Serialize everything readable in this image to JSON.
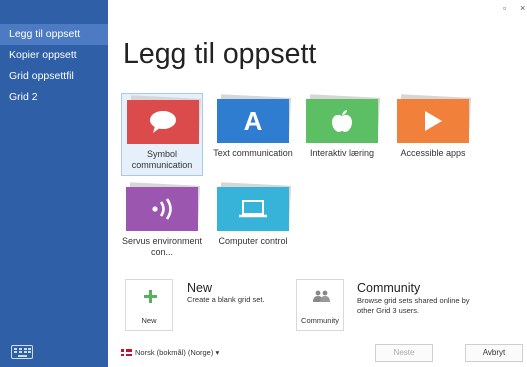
{
  "sidebar": {
    "items": [
      {
        "label": "Legg til oppsett"
      },
      {
        "label": "Kopier oppsett"
      },
      {
        "label": "Grid oppsettfil"
      },
      {
        "label": "Grid 2"
      }
    ],
    "keyboard_icon": "keyboard-icon"
  },
  "window": {
    "maximize_glyph": "▫",
    "close_glyph": "×"
  },
  "main": {
    "title": "Legg til oppsett",
    "tiles": [
      {
        "label": "Symbol communication",
        "color": "#dc4b4b",
        "icon": "speech-bubble-icon",
        "selected": true
      },
      {
        "label": "Text communication",
        "color": "#2e7dd1",
        "icon": "letter-a-icon",
        "glyph": "A"
      },
      {
        "label": "Interaktiv læring",
        "color": "#5cbf63",
        "icon": "apple-icon"
      },
      {
        "label": "Accessible apps",
        "color": "#f0803a",
        "icon": "play-icon"
      },
      {
        "label": "Servus environment con...",
        "color": "#9b57b0",
        "icon": "wireless-signal-icon"
      },
      {
        "label": "Computer control",
        "color": "#37b3d9",
        "icon": "laptop-icon"
      }
    ],
    "new_card": {
      "title": "New",
      "desc": "Create a blank grid set.",
      "caption": "New",
      "icon_color": "#57b05c"
    },
    "community_card": {
      "title": "Community",
      "desc": "Browse grid sets shared online by other Grid 3 users.",
      "caption": "Community",
      "icon_color": "#888888"
    }
  },
  "footer": {
    "language": "Norsk (bokmål) (Norge)",
    "language_arrow": "▾",
    "next_label": "Neste",
    "cancel_label": "Avbryt"
  }
}
